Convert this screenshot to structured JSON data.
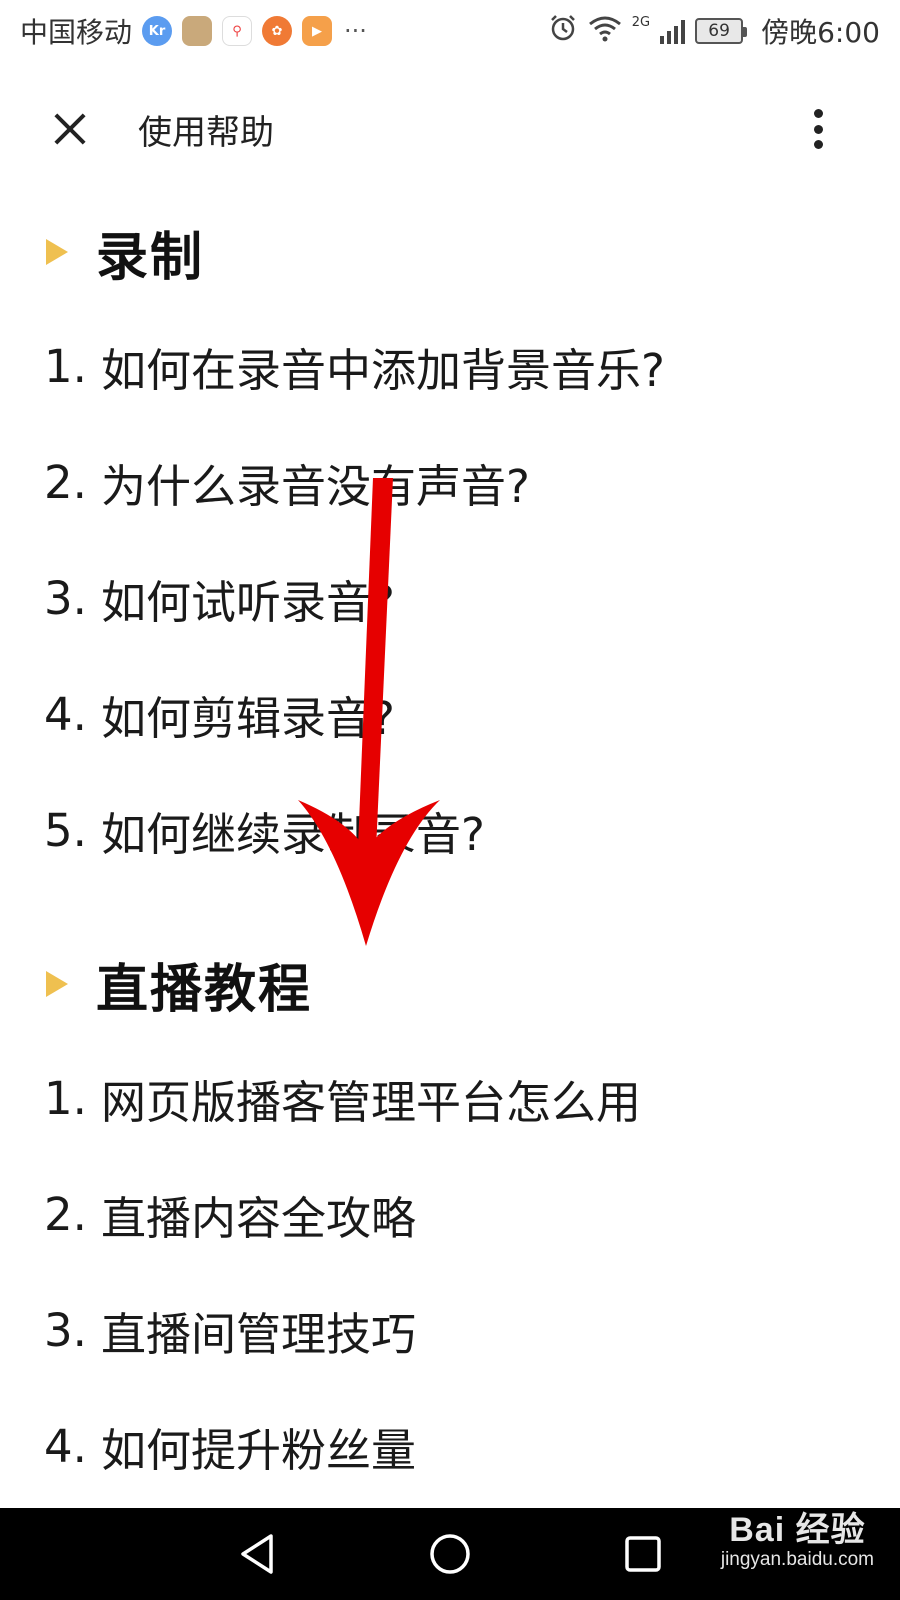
{
  "status_bar": {
    "carrier": "中国移动",
    "network": "2G",
    "battery": "69",
    "time": "傍晚6:00",
    "app_icons": [
      "36kr-icon",
      "photo-app-icon",
      "maps-icon",
      "game-app-icon",
      "video-app-icon"
    ],
    "more": "···"
  },
  "app_bar": {
    "title": "使用帮助"
  },
  "sections": [
    {
      "title": "录制",
      "items": [
        {
          "num": "1.",
          "text": "如何在录音中添加背景音乐?"
        },
        {
          "num": "2.",
          "text": "为什么录音没有声音?"
        },
        {
          "num": "3.",
          "text": "如何试听录音?"
        },
        {
          "num": "4.",
          "text": "如何剪辑录音?"
        },
        {
          "num": "5.",
          "text": "如何继续录制录音?"
        }
      ]
    },
    {
      "title": "直播教程",
      "items": [
        {
          "num": "1.",
          "text": "网页版播客管理平台怎么用"
        },
        {
          "num": "2.",
          "text": "直播内容全攻略"
        },
        {
          "num": "3.",
          "text": "直播间管理技巧"
        },
        {
          "num": "4.",
          "text": "如何提升粉丝量"
        }
      ]
    }
  ],
  "colors": {
    "accent_triangle": "#efc050",
    "arrow": "#e60000",
    "nav_bar": "#000000"
  },
  "watermark": {
    "brand": "Bai 经验",
    "url": "jingyan.baidu.com"
  }
}
